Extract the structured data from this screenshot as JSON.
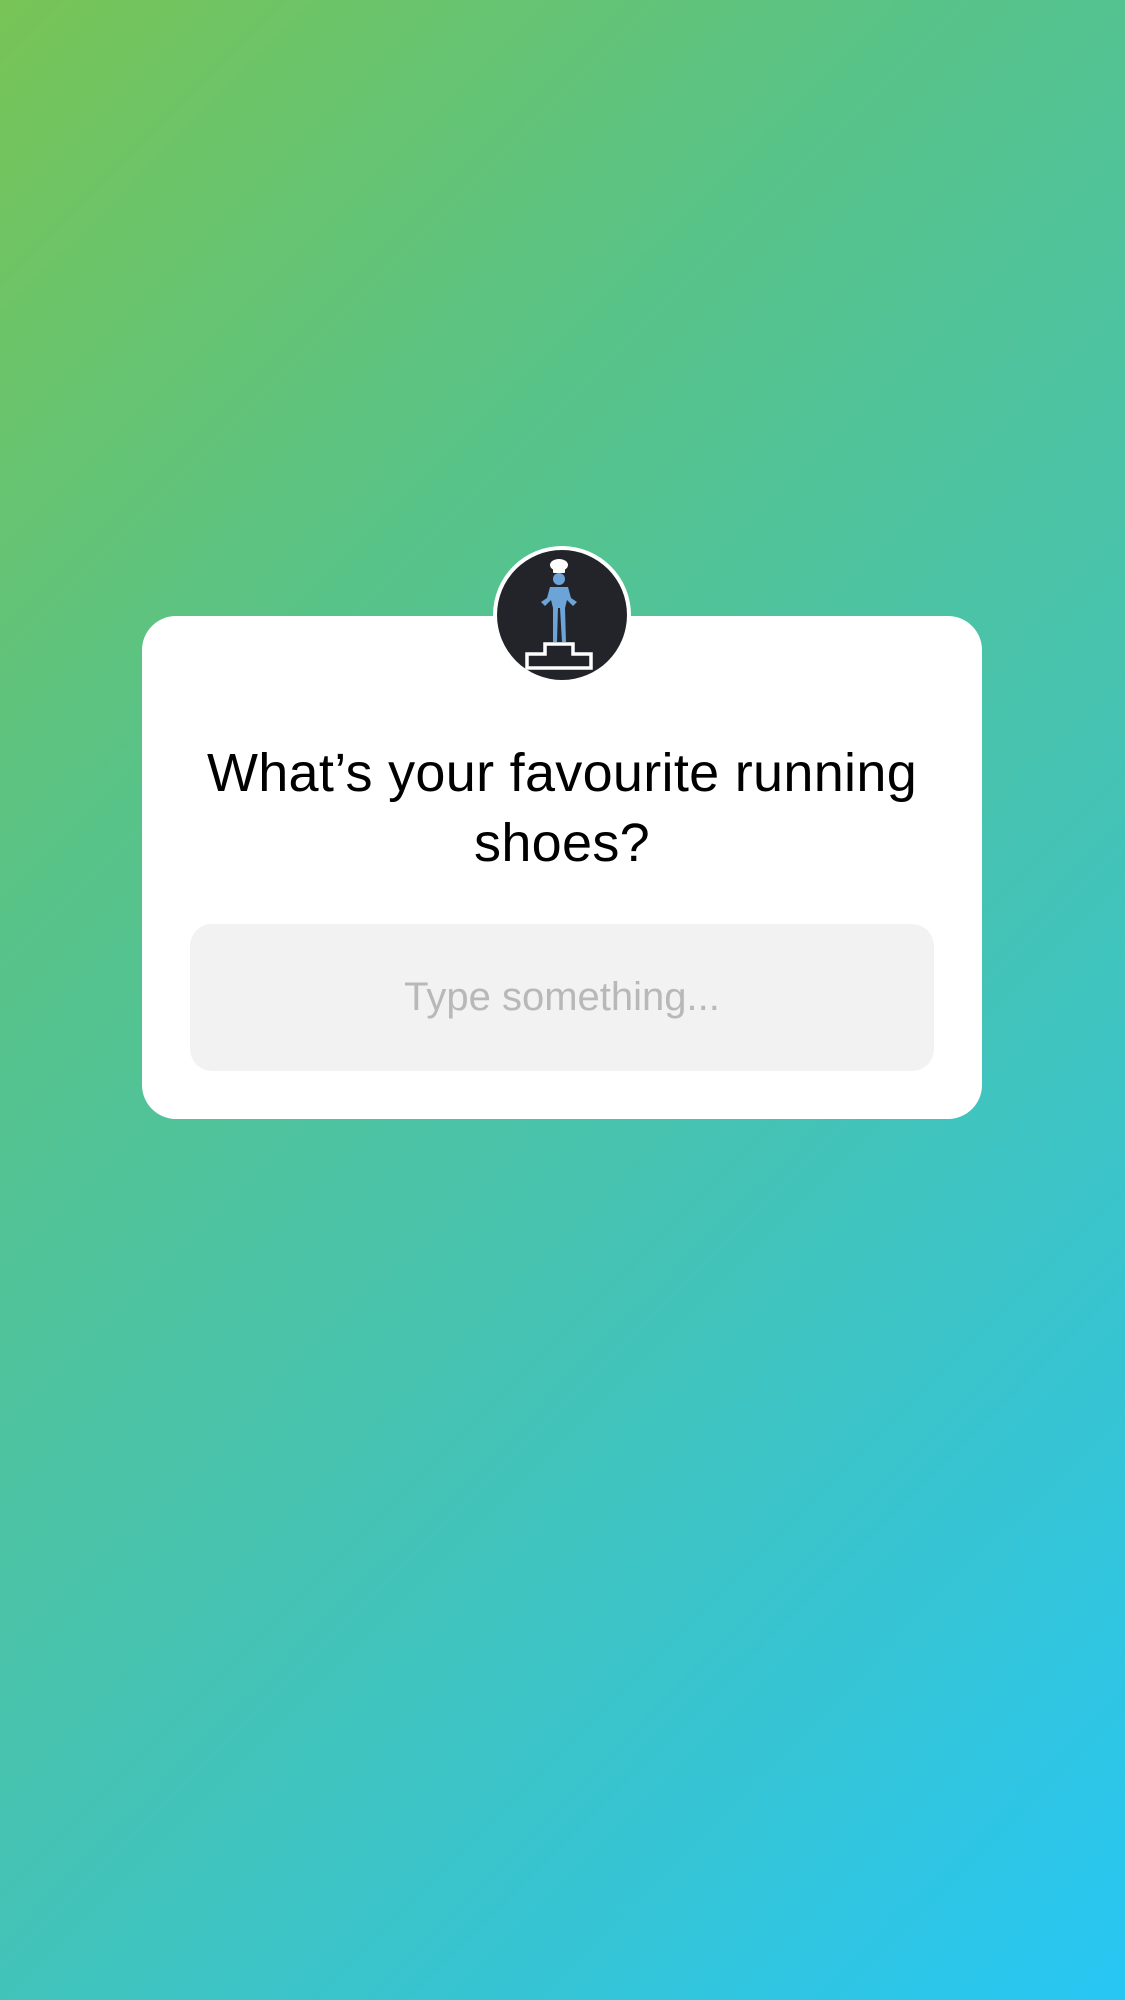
{
  "story": {
    "question": "What’s your favourite running shoes?",
    "answer_placeholder": "Type something...",
    "avatar_icon": "podium-chef-icon"
  },
  "colors": {
    "gradient_start": "#78c456",
    "gradient_end": "#27c6f4",
    "card_background": "#ffffff",
    "field_background": "#f2f2f2",
    "placeholder_text": "#b8b8b8",
    "avatar_background": "#222429",
    "figure_blue": "#6ca4d8"
  }
}
